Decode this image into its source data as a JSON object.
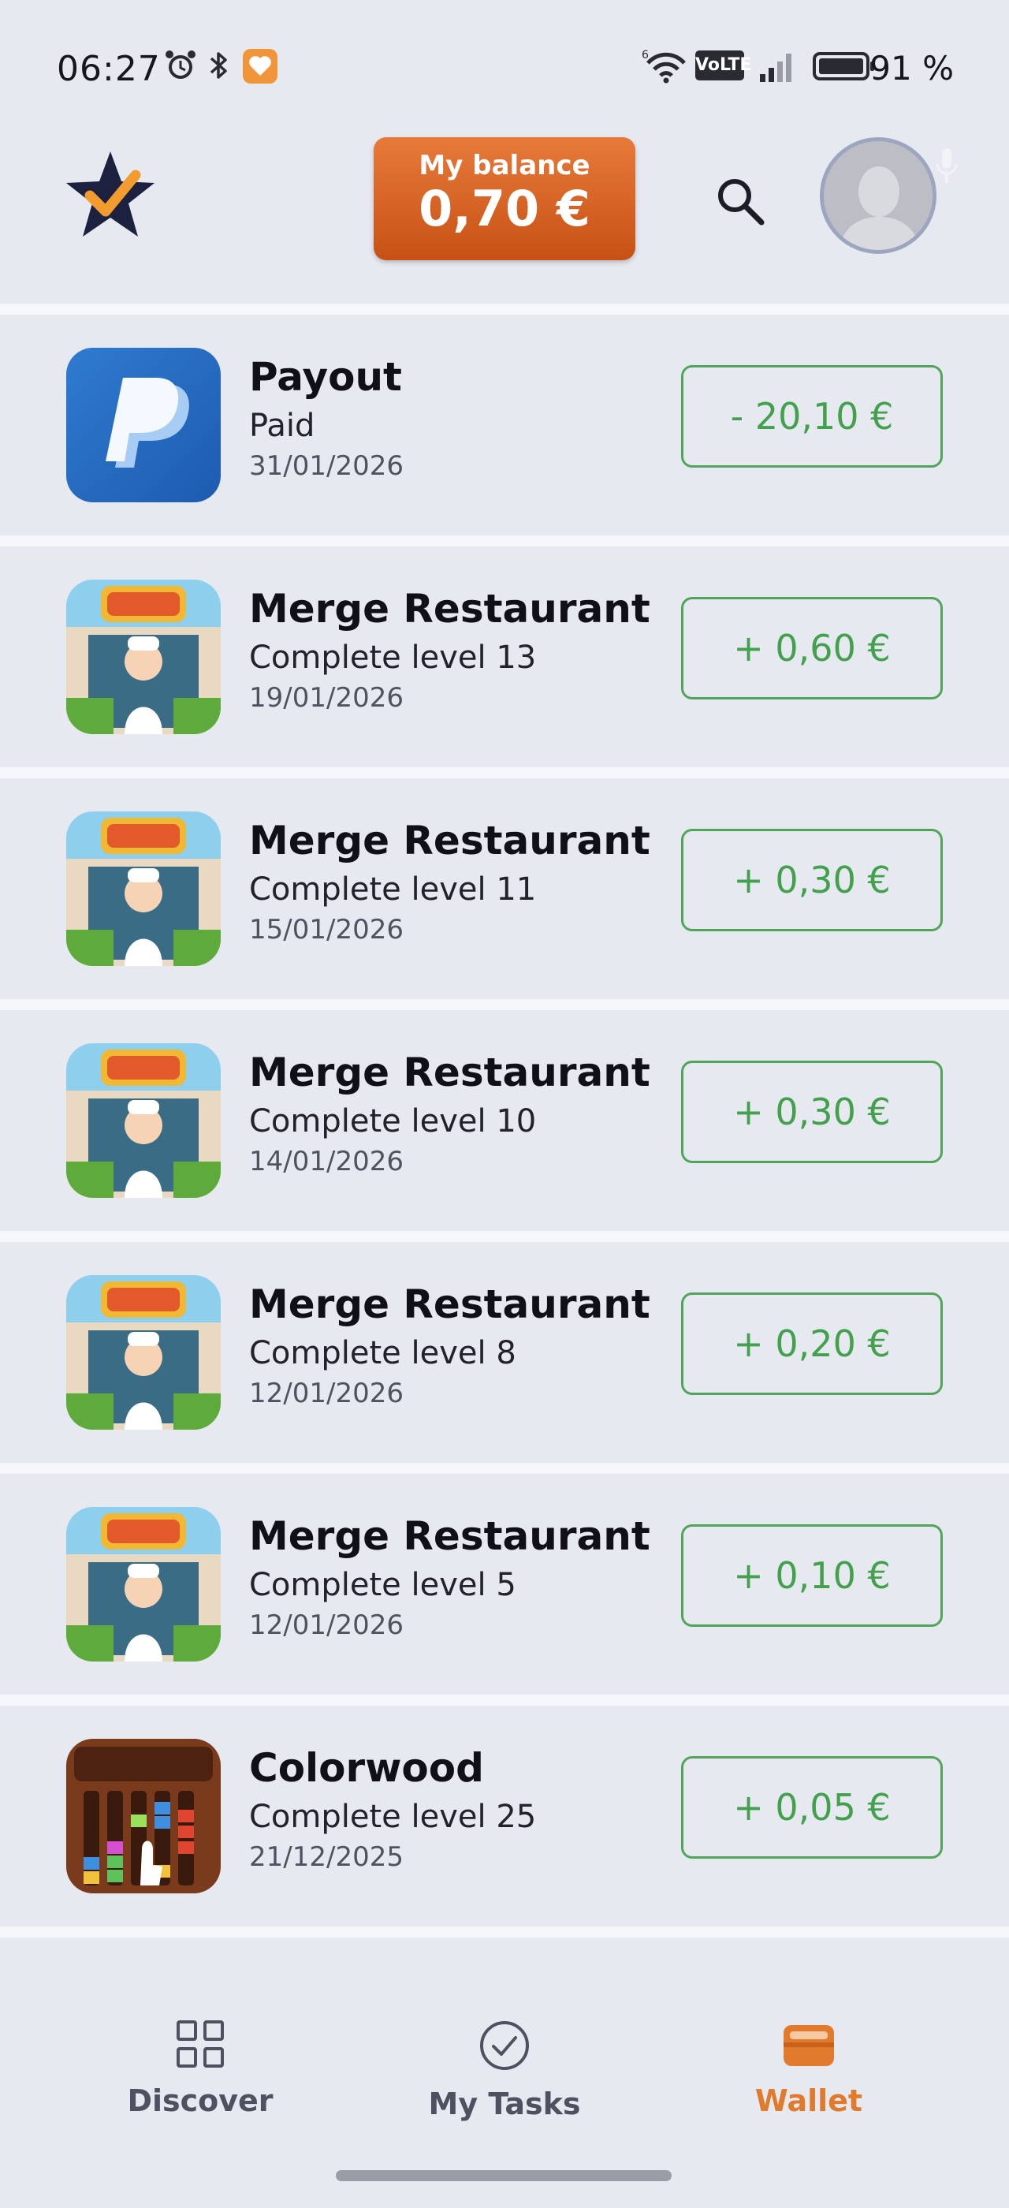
{
  "status_bar": {
    "time": "06:27",
    "network": "VoLTE",
    "battery": "91 %"
  },
  "header": {
    "balance_label": "My balance",
    "balance_value": "0,70 €"
  },
  "transactions": [
    {
      "title": "Payout",
      "subtitle": "Paid",
      "date": "31/01/2026",
      "amount": "- 20,10 €",
      "icon": "paypal-icon"
    },
    {
      "title": "Merge Restaurant",
      "subtitle": "Complete level 13",
      "date": "19/01/2026",
      "amount": "+ 0,60 €",
      "icon": "merge-restaurant-icon"
    },
    {
      "title": "Merge Restaurant",
      "subtitle": "Complete level 11",
      "date": "15/01/2026",
      "amount": "+ 0,30 €",
      "icon": "merge-restaurant-icon"
    },
    {
      "title": "Merge Restaurant",
      "subtitle": "Complete level 10",
      "date": "14/01/2026",
      "amount": "+ 0,30 €",
      "icon": "merge-restaurant-icon"
    },
    {
      "title": "Merge Restaurant",
      "subtitle": "Complete level 8",
      "date": "12/01/2026",
      "amount": "+ 0,20 €",
      "icon": "merge-restaurant-icon"
    },
    {
      "title": "Merge Restaurant",
      "subtitle": "Complete level 5",
      "date": "12/01/2026",
      "amount": "+ 0,10 €",
      "icon": "merge-restaurant-icon"
    },
    {
      "title": "Colorwood",
      "subtitle": "Complete level 25",
      "date": "21/12/2025",
      "amount": "+ 0,05 €",
      "icon": "colorwood-icon"
    }
  ],
  "nav": {
    "discover": "Discover",
    "tasks": "My Tasks",
    "wallet": "Wallet",
    "active": "wallet"
  },
  "colors": {
    "accent": "#e07a2c",
    "positive": "#43a14e",
    "background": "#e7e9f0"
  }
}
